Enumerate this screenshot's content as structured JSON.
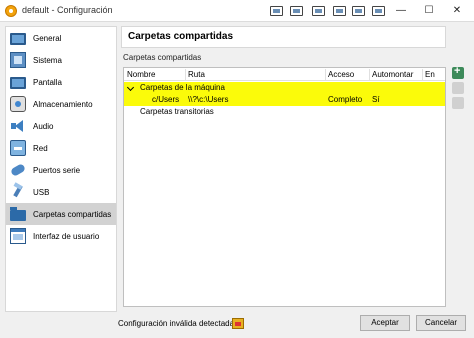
{
  "window": {
    "title": "default - Configuración",
    "toolbar_icons": [
      "display-icon",
      "record-icon",
      "screen-icon",
      "network-icon",
      "share-icon",
      "clipboard-icon"
    ],
    "controls": {
      "minimize": "—",
      "maximize": "☐",
      "close": "✕"
    }
  },
  "sidebar": {
    "items": [
      {
        "label": "General",
        "icon": "monitor-icon"
      },
      {
        "label": "Sistema",
        "icon": "system-icon"
      },
      {
        "label": "Pantalla",
        "icon": "display-icon"
      },
      {
        "label": "Almacenamiento",
        "icon": "storage-icon"
      },
      {
        "label": "Audio",
        "icon": "audio-icon"
      },
      {
        "label": "Red",
        "icon": "network-icon"
      },
      {
        "label": "Puertos serie",
        "icon": "serial-port-icon"
      },
      {
        "label": "USB",
        "icon": "usb-icon"
      },
      {
        "label": "Carpetas compartidas",
        "icon": "shared-folder-icon",
        "selected": true
      },
      {
        "label": "Interfaz de usuario",
        "icon": "user-interface-icon"
      }
    ]
  },
  "main": {
    "header": "Carpetas compartidas",
    "section_title": "Carpetas compartidas",
    "table": {
      "columns": [
        "Nombre",
        "Ruta",
        "Acceso",
        "Automontar",
        "En"
      ],
      "groups": [
        {
          "label": "Carpetas de la máquina",
          "expanded": true,
          "highlighted": true
        },
        {
          "label": "Carpetas transitorias",
          "expanded": false,
          "highlighted": false
        }
      ],
      "rows": [
        {
          "name": "c/Users",
          "path": "\\\\?\\c:\\Users",
          "access": "Completo",
          "automount": "Sí",
          "at": ""
        }
      ],
      "highlight_color": "#fbfb0a"
    },
    "side_tools": [
      "add-share-icon",
      "edit-share-icon",
      "remove-share-icon"
    ]
  },
  "footer": {
    "warning": "Configuración inválida detectada",
    "accept": "Aceptar",
    "cancel": "Cancelar"
  }
}
